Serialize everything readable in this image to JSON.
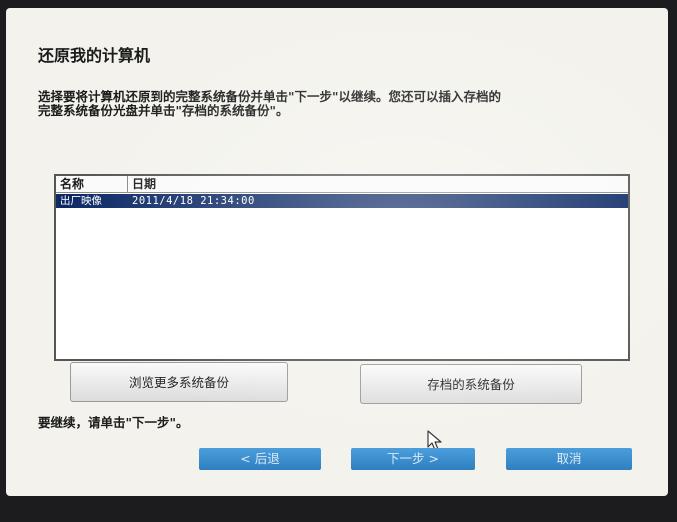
{
  "window": {
    "title": "还原我的计算机"
  },
  "instructions": {
    "line1": "选择要将计算机还原到的完整系统备份并单击\"下一步\"以继续。您还可以插入存档的",
    "line2": "完整系统备份光盘并单击\"存档的系统备份\"。"
  },
  "backup_list": {
    "columns": [
      "名称",
      "日期"
    ],
    "rows": [
      {
        "name": "出厂映像",
        "date": "2011/4/18 21:34:00",
        "selected": true
      }
    ]
  },
  "buttons": {
    "browse": "浏览更多系统备份",
    "archived": "存档的系统备份"
  },
  "hint": "要继续，请单击\"下一步\"。",
  "nav": {
    "back": "< 后退",
    "next": "下一步 >",
    "cancel": "取消"
  },
  "colors": {
    "selection": "#0e2a66",
    "nav_button": "#3a8ccd",
    "screen_background": "#f3f2ec"
  }
}
